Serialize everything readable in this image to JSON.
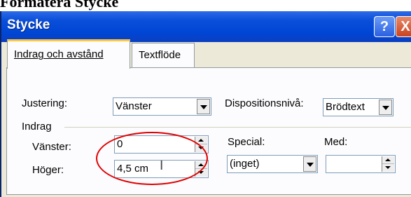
{
  "outer_title": "Formatera Stycke",
  "window": {
    "title": "Stycke",
    "help_glyph": "?",
    "close_glyph": "X"
  },
  "tabs": [
    {
      "label": "Indrag och avstånd",
      "active": true
    },
    {
      "label": "Textflöde",
      "active": false
    }
  ],
  "fields": {
    "justering": {
      "label": "Justering:",
      "value": "Vänster"
    },
    "disposition": {
      "label": "Dispositionsnivå:",
      "value": "Brödtext"
    },
    "indrag_group": "Indrag",
    "vanster": {
      "label": "Vänster:",
      "value": "0"
    },
    "hoger": {
      "label": "Höger:",
      "value": "4,5 cm"
    },
    "special": {
      "label": "Special:",
      "value": "(inget)"
    },
    "med": {
      "label": "Med:",
      "value": ""
    }
  },
  "annotation": {
    "highlight_color": "#e00000",
    "target": "hoger-field"
  },
  "colors": {
    "titlebar": "#0046d5",
    "dialog_bg": "#ece9d8",
    "active_tab_accent": "#ffc83c"
  }
}
